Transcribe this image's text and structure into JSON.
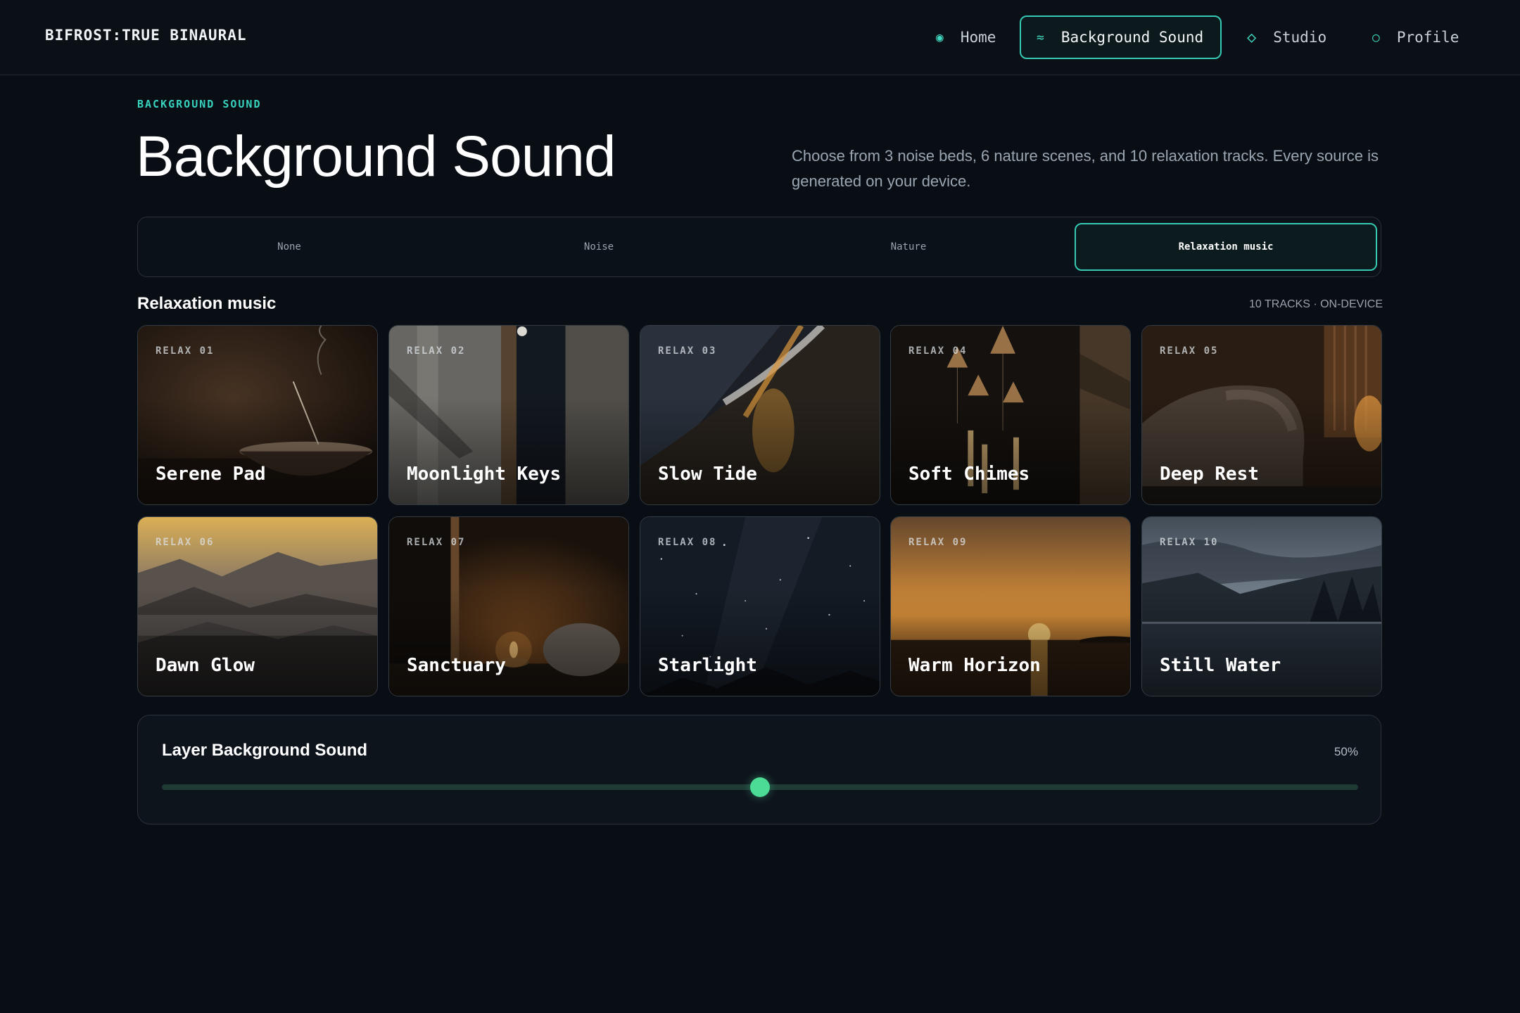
{
  "app": {
    "brand": "BIFROST:TRUE BINAURAL"
  },
  "nav": [
    {
      "icon": "dot-icon",
      "glyph": "◉",
      "label": "Home"
    },
    {
      "icon": "wave-icon",
      "glyph": "≈",
      "label": "Background Sound",
      "active": true
    },
    {
      "icon": "diamond-icon",
      "glyph": "◇",
      "label": "Studio"
    },
    {
      "icon": "circle-icon",
      "glyph": "○",
      "label": "Profile"
    }
  ],
  "header": {
    "eyebrow": "BACKGROUND SOUND",
    "title": "Background Sound",
    "description": "Choose from 3 noise beds, 6 nature scenes, and 10 relaxation tracks. Every source is generated on your device."
  },
  "tabs": [
    {
      "label": "None"
    },
    {
      "label": "Noise"
    },
    {
      "label": "Nature"
    },
    {
      "label": "Relaxation music",
      "active": true
    }
  ],
  "section": {
    "title": "Relaxation music",
    "meta": "10 TRACKS · ON-DEVICE"
  },
  "tracks": [
    {
      "code": "RELAX 01",
      "name": "Serene Pad"
    },
    {
      "code": "RELAX 02",
      "name": "Moonlight Keys"
    },
    {
      "code": "RELAX 03",
      "name": "Slow Tide"
    },
    {
      "code": "RELAX 04",
      "name": "Soft Chimes"
    },
    {
      "code": "RELAX 05",
      "name": "Deep Rest"
    },
    {
      "code": "RELAX 06",
      "name": "Dawn Glow"
    },
    {
      "code": "RELAX 07",
      "name": "Sanctuary"
    },
    {
      "code": "RELAX 08",
      "name": "Starlight"
    },
    {
      "code": "RELAX 09",
      "name": "Warm Horizon"
    },
    {
      "code": "RELAX 10",
      "name": "Still Water"
    }
  ],
  "layer": {
    "title": "Layer Background Sound",
    "value_label": "50%",
    "level": 0.5
  },
  "colors": {
    "accent": "#36c9b3",
    "slider": "#4ddc96",
    "background": "#090d14"
  }
}
